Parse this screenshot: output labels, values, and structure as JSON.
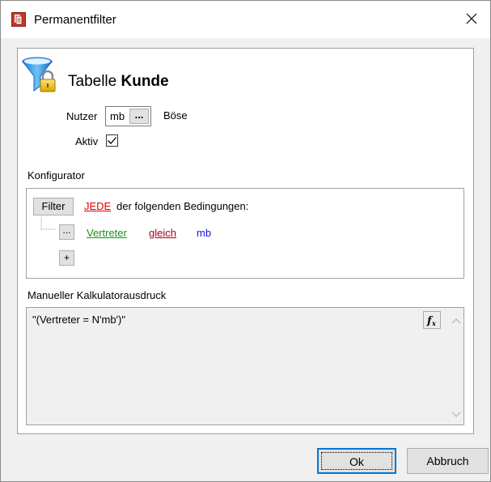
{
  "window": {
    "title": "Permanentfilter"
  },
  "header": {
    "table_prefix": "Tabelle",
    "table_name": "Kunde"
  },
  "user": {
    "label": "Nutzer",
    "value": "mb",
    "browse_label": "...",
    "display_name": "Böse"
  },
  "active": {
    "label": "Aktiv",
    "checked": true
  },
  "configurator": {
    "label": "Konfigurator",
    "filter_button": "Filter",
    "quantifier": "JEDE",
    "condition_text": "der folgenden Bedingungen:",
    "rows": [
      {
        "menu": "...",
        "field": "Vertreter",
        "operator": "gleich",
        "value": "mb"
      }
    ],
    "add_button": "+"
  },
  "calculator": {
    "label": "Manueller Kalkulatorausdruck",
    "expression": "\"(Vertreter = N'mb')\""
  },
  "buttons": {
    "ok": "Ok",
    "cancel": "Abbruch"
  },
  "colors": {
    "quantifier": "#e00000",
    "field": "#1a8f1a",
    "operator": "#a50021",
    "value": "#1515d6",
    "focus": "#0078d7"
  },
  "icons": {
    "app": "report-icon",
    "close": "close-icon",
    "header": "filter-lock-icon",
    "function": "function-icon"
  }
}
